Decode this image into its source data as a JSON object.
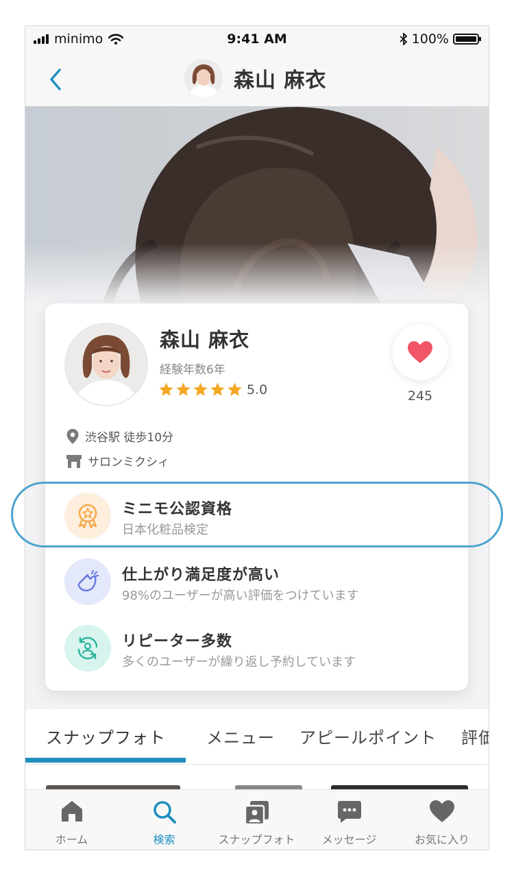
{
  "status_bar": {
    "carrier": "minimo",
    "time": "9:41 AM",
    "battery": "100%"
  },
  "nav": {
    "title": "森山 麻衣"
  },
  "profile": {
    "name": "森山 麻衣",
    "experience": "経験年数6年",
    "rating": "5.0",
    "rating_stars": 5,
    "favorites": "245",
    "station": "渋谷駅 徒歩10分",
    "salon": "サロンミクシィ"
  },
  "features": [
    {
      "title": "ミニモ公認資格",
      "subtitle": "日本化粧品検定"
    },
    {
      "title": "仕上がり満足度が高い",
      "subtitle": "98%のユーザーが高い評価をつけています"
    },
    {
      "title": "リピーター多数",
      "subtitle": "多くのユーザーが繰り返し予約しています"
    }
  ],
  "tabs": [
    "スナップフォト",
    "メニュー",
    "アピールポイント",
    "評価"
  ],
  "active_tab": "スナップフォト",
  "tabbar": [
    {
      "label": "ホーム",
      "icon": "home-icon"
    },
    {
      "label": "検索",
      "icon": "search-icon",
      "active": true
    },
    {
      "label": "スナップフォト",
      "icon": "snap-photo-icon"
    },
    {
      "label": "メッセージ",
      "icon": "message-icon"
    },
    {
      "label": "お気に入り",
      "icon": "heart-icon"
    }
  ],
  "colors": {
    "accent": "#1e8fbf",
    "heart": "#f25468",
    "star": "#f5a623",
    "highlight": "#4aa3cf"
  }
}
